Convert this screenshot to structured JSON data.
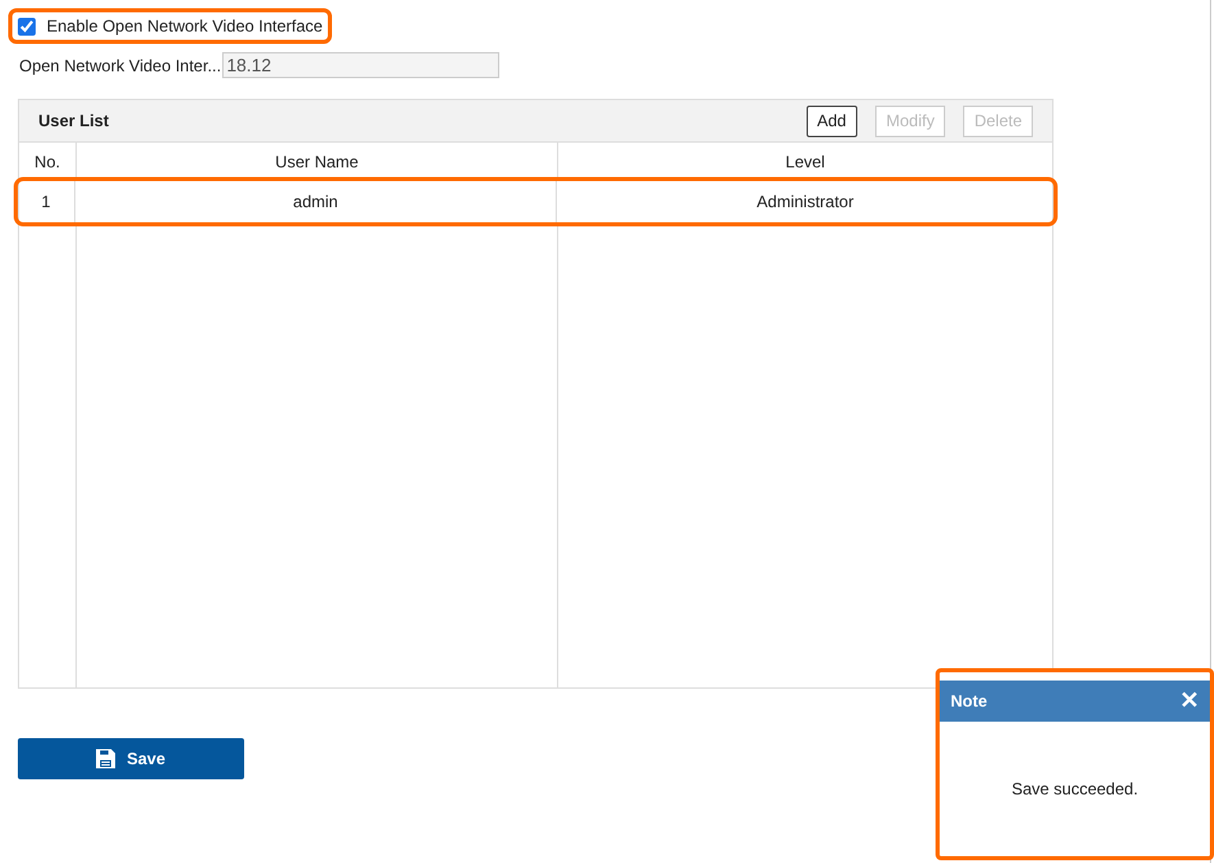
{
  "enable_checkbox": {
    "label": "Enable Open Network Video Interface",
    "checked": true
  },
  "version_field": {
    "label": "Open Network Video Inter...",
    "value": "18.12"
  },
  "user_list": {
    "title": "User List",
    "buttons": [
      {
        "label": "Add",
        "disabled": false
      },
      {
        "label": "Modify",
        "disabled": true
      },
      {
        "label": "Delete",
        "disabled": true
      }
    ],
    "columns": [
      "No.",
      "User Name",
      "Level"
    ],
    "rows": [
      [
        "1",
        "admin",
        "Administrator"
      ]
    ]
  },
  "save_button": {
    "label": "Save"
  },
  "dialog": {
    "title": "Note",
    "close": "✕",
    "message": "Save succeeded."
  }
}
